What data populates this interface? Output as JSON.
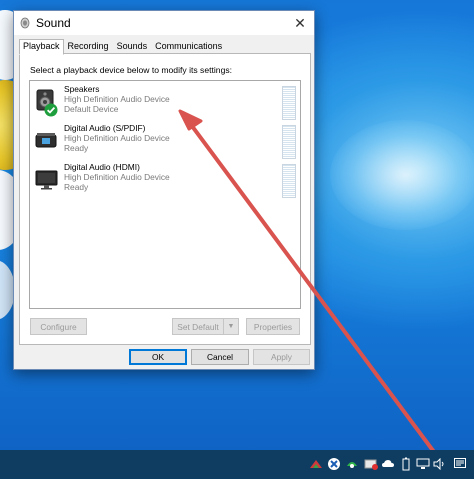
{
  "window": {
    "title": "Sound",
    "close_label": "✕"
  },
  "tabs": [
    {
      "label": "Playback",
      "active": true
    },
    {
      "label": "Recording",
      "active": false
    },
    {
      "label": "Sounds",
      "active": false
    },
    {
      "label": "Communications",
      "active": false
    }
  ],
  "instruction": "Select a playback device below to modify its settings:",
  "devices": [
    {
      "name": "Speakers",
      "line2": "High Definition Audio Device",
      "line3": "Default Device",
      "icon": "speaker-icon",
      "default": true
    },
    {
      "name": "Digital Audio (S/PDIF)",
      "line2": "High Definition Audio Device",
      "line3": "Ready",
      "icon": "digital-audio-icon",
      "default": false
    },
    {
      "name": "Digital Audio (HDMI)",
      "line2": "High Definition Audio Device",
      "line3": "Ready",
      "icon": "monitor-icon",
      "default": false
    }
  ],
  "buttons": {
    "configure": "Configure",
    "set_default": "Set Default",
    "properties": "Properties",
    "ok": "OK",
    "cancel": "Cancel",
    "apply": "Apply"
  },
  "taskbar": {
    "icons": [
      "network-shortcut-icon",
      "x-app-icon",
      "shield-app-icon",
      "display-app-icon",
      "cloud-icon",
      "battery-icon",
      "network-icon",
      "volume-icon",
      "notification-icon"
    ]
  },
  "colors": {
    "accent": "#0078d7",
    "annotation_arrow": "#d9534f",
    "taskbar": "#0e3d61",
    "check_badge": "#1e9e3c"
  }
}
